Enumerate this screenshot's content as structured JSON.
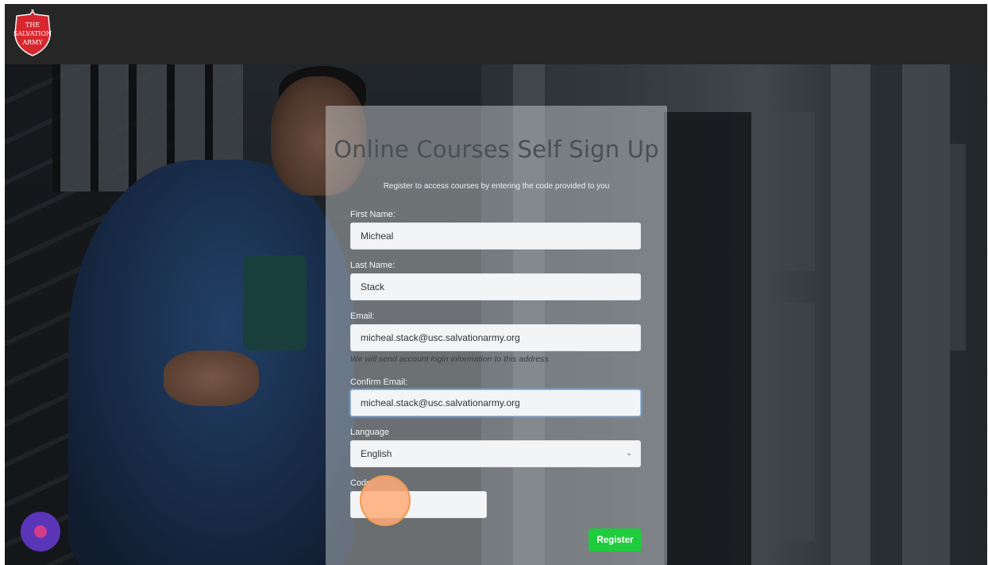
{
  "header": {
    "logo_text": "THE SALVATION ARMY",
    "logo_color": "#d8262f"
  },
  "form": {
    "title": "Online Courses Self Sign Up",
    "subtitle": "Register to access courses by entering the code provided to you",
    "first_name": {
      "label": "First Name:",
      "value": "Micheal"
    },
    "last_name": {
      "label": "Last Name:",
      "value": "Stack"
    },
    "email": {
      "label": "Email:",
      "value": "micheal.stack@usc.salvationarmy.org",
      "hint": "We will send account login information to this address"
    },
    "confirm_email": {
      "label": "Confirm Email:",
      "value": "micheal.stack@usc.salvationarmy.org"
    },
    "language": {
      "label": "Language",
      "selected": "English"
    },
    "code": {
      "label": "Code:",
      "value": ""
    },
    "register_label": "Register",
    "register_color": "#1fcc3d"
  },
  "chat_widget": {
    "icon": "chat-bubble-icon",
    "color": "#5a35b8"
  }
}
